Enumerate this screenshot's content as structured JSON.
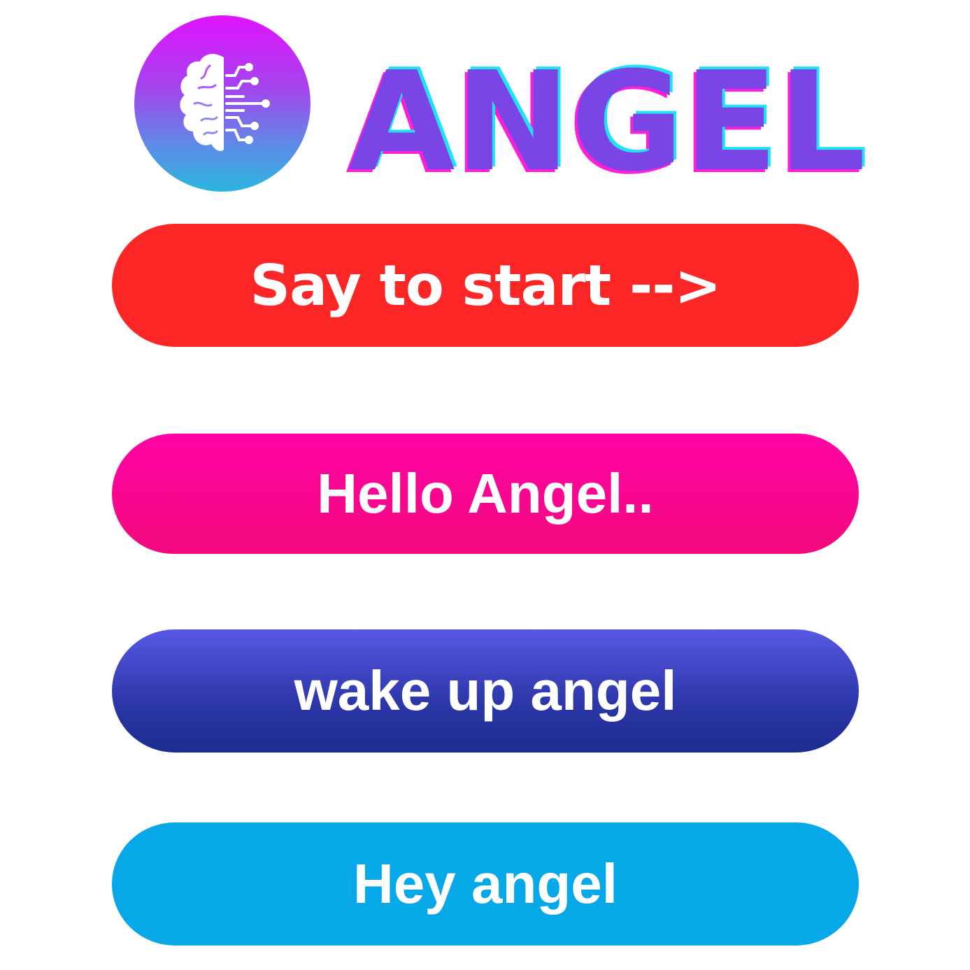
{
  "brand": {
    "name": "ANGEL",
    "logo_icon": "brain-circuit-icon",
    "colors": {
      "logo_gradient_top": "#e013ff",
      "logo_gradient_bottom": "#2ab6e0",
      "wordmark_fill": "#7b45e6",
      "wordmark_shadow_cyan": "#1fe2f2",
      "wordmark_shadow_pink": "#ff1fd8"
    }
  },
  "buttons": [
    {
      "label": "Say to start -->",
      "color": "#fd2626"
    },
    {
      "label": "Hello Angel..",
      "color": "#ff03a5"
    },
    {
      "label": "wake up angel",
      "color": "#2c36a8"
    },
    {
      "label": "Hey angel",
      "color": "#06a8e8"
    }
  ]
}
